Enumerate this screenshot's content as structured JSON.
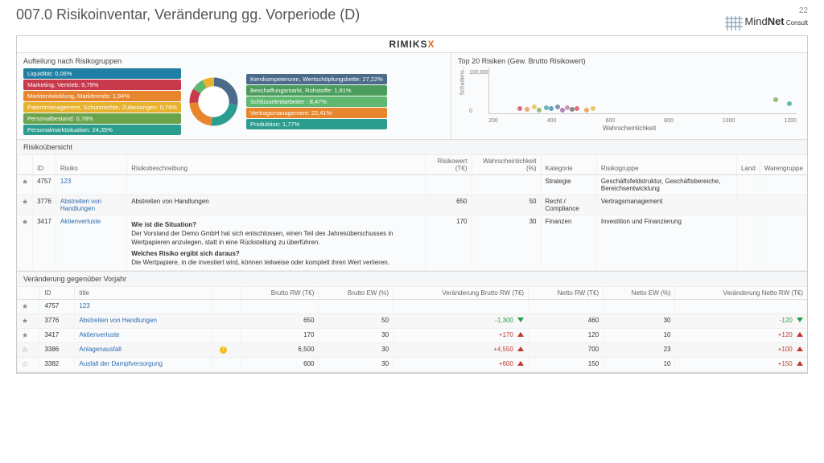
{
  "page_number": "22",
  "page_title": "007.0 Risikoinventar, Veränderung gg. Vorperiode (D)",
  "logo": {
    "t1": "Mind",
    "t2": "Net",
    "t3": " Consult"
  },
  "brand": {
    "a": "RIMIKS",
    "b": "X"
  },
  "panels": {
    "left_title": "Aufteilung nach Risikogruppen",
    "right_title": "Top 20 Risiken (Gew. Brutto Risikowert)",
    "y_axis": "Schadens...",
    "x_axis": "Wahrscheinlichkeit",
    "yticks": [
      "100,000",
      "0"
    ],
    "xticks": [
      "200",
      "400",
      "600",
      "800",
      "1000",
      "1200"
    ]
  },
  "donut_tags_left": [
    {
      "label": "Liquidität: 0,06%",
      "color": "#1f7ea3"
    },
    {
      "label": "Marketing, Vertrieb: 9,79%",
      "color": "#c83a4b"
    },
    {
      "label": "Marktentwicklung, Markttrends: 1,94%",
      "color": "#e8862e"
    },
    {
      "label": "Patentmanagement, Schutzrechte, Zulassungen: 0,78%",
      "color": "#e8b12e"
    },
    {
      "label": "Personalbestand: 0,78%",
      "color": "#6aa34b"
    },
    {
      "label": "Personalmarktsituation: 24,35%",
      "color": "#2a9d8f"
    }
  ],
  "donut_tags_right": [
    {
      "label": "Kernkompetenzen, Wertschöpfungskette: 27,22%",
      "color": "#4a6b8a"
    },
    {
      "label": "Beschaffungsmarkt, Rohstoffe: 1,81%",
      "color": "#4a9d5a"
    },
    {
      "label": "Schlüsselmitarbeiter : 8,47%",
      "color": "#5fb870"
    },
    {
      "label": "Vertragsmanagement: 22,41%",
      "color": "#e8862e"
    },
    {
      "label": "Produktion: 1,77%",
      "color": "#2a9d8f"
    }
  ],
  "overview": {
    "title": "Risikoübersicht",
    "cols": [
      "",
      "ID",
      "Risiko",
      "Risikobeschreibung",
      "Risikowert (T€)",
      "Wahrscheinlichkeit (%)",
      "Kategorie",
      "Risikogruppe",
      "Land",
      "Warengruppe"
    ],
    "rows": [
      {
        "star": true,
        "id": "4757",
        "risk": "123",
        "desc": "",
        "rw": "",
        "pw": "",
        "cat": "Strategie",
        "grp": "Geschäftsfeldstruktur, Geschäftsbereiche, Bereichsentwicklung",
        "land": "",
        "wg": ""
      },
      {
        "star": true,
        "id": "3776",
        "risk": "Abstreiten von Handlungen",
        "desc": "Abstreiten von Handlungen",
        "rw": "650",
        "pw": "50",
        "cat": "Recht / Compliance",
        "grp": "Vertragsmanagement",
        "land": "",
        "wg": ""
      },
      {
        "star": true,
        "id": "3417",
        "risk": "Aktienverluste",
        "desc": "",
        "rw": "170",
        "pw": "30",
        "cat": "Finanzen",
        "grp": "Investition und Finanzierung",
        "land": "",
        "wg": "",
        "long_q1": "Wie ist die Situation?",
        "long_t1": "Der Vorstand der Demo GmbH hat sich entschlossen, einen Teil des Jahresüberschusses in Wertpapieren anzulegen, statt in eine Rückstellung zu überführen.",
        "long_q2": "Welches Risiko ergibt sich daraus?",
        "long_t2": "Die Wertpapiere, in die investiert wird, können teilweise oder komplett ihren Wert verlieren."
      }
    ]
  },
  "change": {
    "title": "Veränderung gegenüber Vorjahr",
    "cols": [
      "",
      "ID",
      "title",
      "",
      "Brutto RW (T€)",
      "Brutto EW (%)",
      "Veränderung Brutto RW (T€)",
      "Netto RW (T€)",
      "Netto EW (%)",
      "Veränderung Netto RW (T€)"
    ],
    "rows": [
      {
        "star": true,
        "id": "4757",
        "title": "123",
        "warn": false,
        "brw": "",
        "bew": "",
        "dvb": "",
        "dir_b": "",
        "nrw": "",
        "new": "",
        "dvn": "",
        "dir_n": ""
      },
      {
        "star": true,
        "id": "3776",
        "title": "Abstreiten von Handlungen",
        "warn": false,
        "brw": "650",
        "bew": "50",
        "dvb": "-1,300",
        "dir_b": "down",
        "nrw": "460",
        "new": "30",
        "dvn": "-120",
        "dir_n": "down"
      },
      {
        "star": true,
        "id": "3417",
        "title": "Aktienverluste",
        "warn": false,
        "brw": "170",
        "bew": "30",
        "dvb": "+170",
        "dir_b": "up",
        "nrw": "120",
        "new": "10",
        "dvn": "+120",
        "dir_n": "up"
      },
      {
        "star": false,
        "id": "3386",
        "title": "Anlagenausfall",
        "warn": true,
        "brw": "6,500",
        "bew": "30",
        "dvb": "+4,550",
        "dir_b": "up",
        "nrw": "700",
        "new": "23",
        "dvn": "+100",
        "dir_n": "up"
      },
      {
        "star": false,
        "id": "3382",
        "title": "Ausfall der Dampfversorgung",
        "warn": false,
        "brw": "600",
        "bew": "30",
        "dvb": "+600",
        "dir_b": "up",
        "nrw": "150",
        "new": "10",
        "dvn": "+150",
        "dir_n": "up"
      }
    ]
  },
  "chart_data": [
    {
      "type": "pie",
      "title": "Aufteilung nach Risikogruppen",
      "series": [
        {
          "name": "Liquidität",
          "value": 0.06
        },
        {
          "name": "Marketing, Vertrieb",
          "value": 9.79
        },
        {
          "name": "Marktentwicklung, Markttrends",
          "value": 1.94
        },
        {
          "name": "Patentmanagement, Schutzrechte, Zulassungen",
          "value": 0.78
        },
        {
          "name": "Personalbestand",
          "value": 0.78
        },
        {
          "name": "Personalmarktsituation",
          "value": 24.35
        },
        {
          "name": "Kernkompetenzen, Wertschöpfungskette",
          "value": 27.22
        },
        {
          "name": "Beschaffungsmarkt, Rohstoffe",
          "value": 1.81
        },
        {
          "name": "Schlüsselmitarbeiter",
          "value": 8.47
        },
        {
          "name": "Vertragsmanagement",
          "value": 22.41
        },
        {
          "name": "Produktion",
          "value": 1.77
        }
      ]
    },
    {
      "type": "scatter",
      "title": "Top 20 Risiken (Gew. Brutto Risikowert)",
      "xlabel": "Wahrscheinlichkeit",
      "ylabel": "Schadens...",
      "xlim": [
        0,
        1300
      ],
      "ylim": [
        0,
        100000
      ],
      "points": [
        {
          "x": 120,
          "y": 5000
        },
        {
          "x": 150,
          "y": 3000
        },
        {
          "x": 180,
          "y": 8000
        },
        {
          "x": 200,
          "y": 2000
        },
        {
          "x": 230,
          "y": 6000
        },
        {
          "x": 250,
          "y": 4000
        },
        {
          "x": 280,
          "y": 9000
        },
        {
          "x": 300,
          "y": 1000
        },
        {
          "x": 320,
          "y": 7000
        },
        {
          "x": 340,
          "y": 3000
        },
        {
          "x": 360,
          "y": 5000
        },
        {
          "x": 400,
          "y": 2000
        },
        {
          "x": 430,
          "y": 4000
        },
        {
          "x": 1200,
          "y": 25000
        },
        {
          "x": 1260,
          "y": 15000
        }
      ]
    }
  ]
}
